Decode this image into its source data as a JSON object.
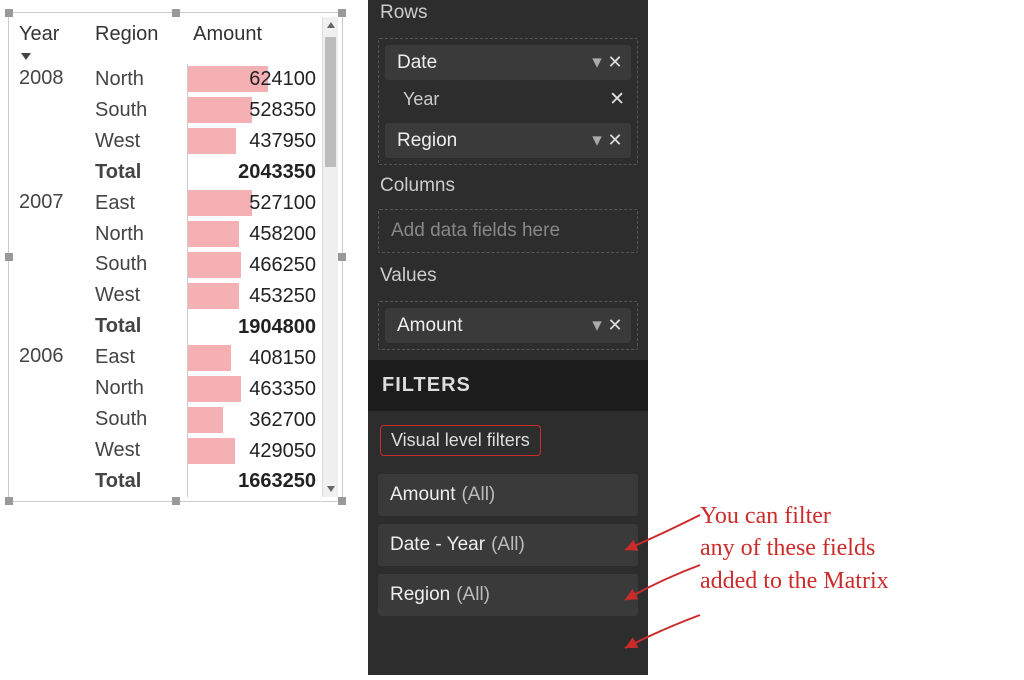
{
  "matrix": {
    "headers": {
      "year": "Year",
      "region": "Region",
      "amount": "Amount"
    },
    "groups": [
      {
        "year": "2008",
        "rows": [
          {
            "region": "North",
            "amount": "624100",
            "bar_pct": 60
          },
          {
            "region": "South",
            "amount": "528350",
            "bar_pct": 48
          },
          {
            "region": "West",
            "amount": "437950",
            "bar_pct": 36
          }
        ],
        "total_label": "Total",
        "total_amount": "2043350"
      },
      {
        "year": "2007",
        "rows": [
          {
            "region": "East",
            "amount": "527100",
            "bar_pct": 48
          },
          {
            "region": "North",
            "amount": "458200",
            "bar_pct": 38
          },
          {
            "region": "South",
            "amount": "466250",
            "bar_pct": 40
          },
          {
            "region": "West",
            "amount": "453250",
            "bar_pct": 38
          }
        ],
        "total_label": "Total",
        "total_amount": "1904800"
      },
      {
        "year": "2006",
        "rows": [
          {
            "region": "East",
            "amount": "408150",
            "bar_pct": 32
          },
          {
            "region": "North",
            "amount": "463350",
            "bar_pct": 40
          },
          {
            "region": "South",
            "amount": "362700",
            "bar_pct": 26
          },
          {
            "region": "West",
            "amount": "429050",
            "bar_pct": 35
          }
        ],
        "total_label": "Total",
        "total_amount": "1663250"
      }
    ]
  },
  "panel": {
    "rows_label": "Rows",
    "columns_label": "Columns",
    "columns_placeholder": "Add data fields here",
    "values_label": "Values",
    "date_chip": "Date",
    "year_sub": "Year",
    "region_chip": "Region",
    "amount_chip": "Amount",
    "filters_heading": "FILTERS",
    "vlf_label": "Visual level filters",
    "filters": [
      {
        "name": "Amount",
        "scope": "(All)"
      },
      {
        "name": "Date - Year",
        "scope": "(All)"
      },
      {
        "name": "Region",
        "scope": "(All)"
      }
    ]
  },
  "annotation": {
    "line1": "You can filter",
    "line2": "any of these fields",
    "line3": "added to the Matrix"
  }
}
